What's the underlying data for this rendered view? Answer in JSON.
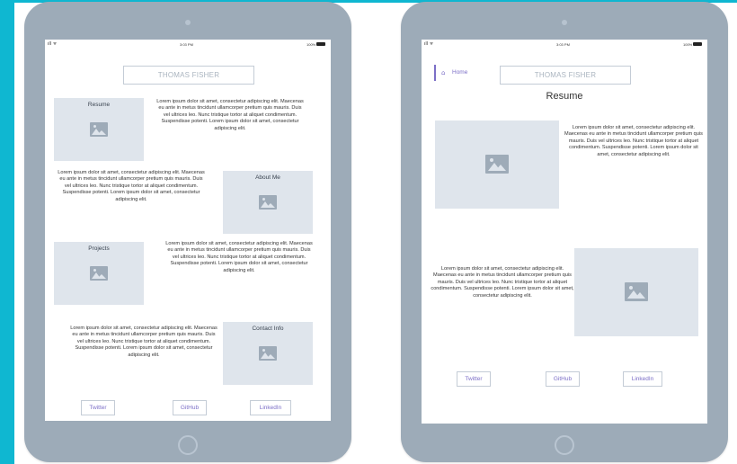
{
  "status_bar": {
    "time": "3:03 PM",
    "battery": "100%",
    "signal": "ıll ᯤ"
  },
  "left_mockup": {
    "name": "THOMAS FISHER",
    "sections": [
      {
        "label": "Resume",
        "text": "Lorem ipsum dolor sit amet, consectetur adipiscing elit. Maecenas eu ante in metus tincidunt ullamcorper pretium quis mauris. Duis vel ultrices leo. Nunc tristique tortor at aliquet condimentum. Suspendisse potenti. Lorem ipsum dolor sit amet, consectetur adipiscing elit."
      },
      {
        "label": "About Me",
        "text": "Lorem ipsum dolor sit amet, consectetur adipiscing elit. Maecenas eu ante in metus tincidunt ullamcorper pretium quis mauris. Duis vel ultrices leo. Nunc tristique tortor at aliquet condimentum. Suspendisse potenti. Lorem ipsum dolor sit amet, consectetur adipiscing elit."
      },
      {
        "label": "Projects",
        "text": "Lorem ipsum dolor sit amet, consectetur adipiscing elit. Maecenas eu ante in metus tincidunt ullamcorper pretium quis mauris. Duis vel ultrices leo. Nunc tristique tortor at aliquet condimentum. Suspendisse potenti. Lorem ipsum dolor sit amet, consectetur adipiscing elit."
      },
      {
        "label": "Contact Info",
        "text": "Lorem ipsum dolor sit amet, consectetur adipiscing elit. Maecenas eu ante in metus tincidunt ullamcorper pretium quis mauris. Duis vel ultrices leo. Nunc tristique tortor at aliquet condimentum. Suspendisse potenti. Lorem ipsum dolor sit amet, consectetur adipiscing elit."
      }
    ],
    "links": [
      "Twitter",
      "GitHub",
      "LinkedIn"
    ]
  },
  "right_mockup": {
    "home_label": "Home",
    "name": "THOMAS FISHER",
    "heading": "Resume",
    "paragraph_1": "Lorem ipsum dolor sit amet, consectetur adipiscing elit. Maecenas eu ante in metus tincidunt ullamcorper pretium quis mauris. Duis vel ultrices leo. Nunc tristique tortor at aliquet condimentum. Suspendisse potenti. Lorem ipsum dolor sit amet, consectetur adipiscing elit.",
    "paragraph_2": "Lorem ipsum dolor sit amet, consectetur adipiscing elit. Maecenas eu ante in metus tincidunt ullamcorper pretium quis mauris. Duis vel ultrices leo. Nunc tristique tortor at aliquet condimentum. Suspendisse potenti. Lorem ipsum dolor sit amet, consectetur adipiscing elit.",
    "links": [
      "Twitter",
      "GitHub",
      "LinkedIn"
    ]
  },
  "icons": {
    "image_placeholder": "image-icon",
    "home": "home-icon"
  },
  "colors": {
    "accent": "#7c6fc7",
    "placeholder": "#dfe5ec",
    "tablet": "#9dabb8",
    "frame": "#0fb7d1"
  }
}
